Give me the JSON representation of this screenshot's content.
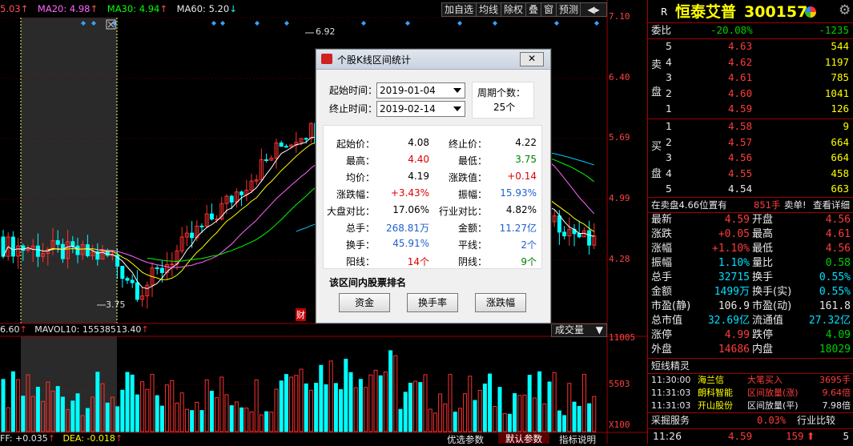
{
  "chart": {
    "ma_legend": [
      {
        "text": "5.03",
        "color": "#ff5050"
      },
      {
        "text": "MA20: 4.98",
        "color": "#ff66ff"
      },
      {
        "text": "MA30: 4.94",
        "color": "#00ff00"
      },
      {
        "text": "MA60: 5.20",
        "color": "#ffffff"
      }
    ],
    "price_ticks": [
      "7.10",
      "6.40",
      "5.69",
      "4.99",
      "4.28"
    ],
    "high_label": "6.92",
    "low_label": "3.75",
    "fin_label": "财",
    "vol_legend_left": "6.60",
    "vol_legend": "MAVOL10: 15538513.40",
    "vol_ticks": [
      "11005",
      "5503",
      "X100"
    ],
    "vol_select": "成交量",
    "indicator_text_1": "FF: +0.035",
    "indicator_text_2": "DEA: -0.018",
    "bottom_tabs": [
      "优选参数",
      "默认参数",
      "指标说明"
    ],
    "top_buttons": [
      "加自选",
      "均线",
      "除权",
      "叠",
      "窗",
      "预测"
    ],
    "colors": {
      "up": "#ff3030",
      "down": "#00ffff",
      "ma5": "#ffffff",
      "ma10": "#ffff00",
      "ma20": "#ff66ff",
      "ma30": "#00ff00",
      "ma60": "#00ccff"
    }
  },
  "dialog": {
    "title": "个股K线区间统计",
    "start_label": "起始时间：",
    "start_value": "2019-01-04",
    "end_label": "终止时间：",
    "end_value": "2019-02-14",
    "period_label": "周期个数：",
    "period_value": "25个",
    "stats_left": [
      {
        "k": "起始价：",
        "v": "4.08",
        "c": "#000000"
      },
      {
        "k": "最高：",
        "v": "4.40",
        "c": "#e00000"
      },
      {
        "k": "均价：",
        "v": "4.19",
        "c": "#000000"
      },
      {
        "k": "涨跌幅：",
        "v": "+3.43%",
        "c": "#e00000"
      },
      {
        "k": "大盘对比：",
        "v": "17.06%",
        "c": "#000000"
      },
      {
        "k": "总手：",
        "v": "268.81万",
        "c": "#1f5fd0"
      },
      {
        "k": "换手：",
        "v": "45.91%",
        "c": "#1f5fd0"
      },
      {
        "k": "阳线：",
        "v": "14个",
        "c": "#e00000"
      }
    ],
    "stats_right": [
      {
        "k": "终止价：",
        "v": "4.22",
        "c": "#000000"
      },
      {
        "k": "最低：",
        "v": "3.75",
        "c": "#008000"
      },
      {
        "k": "涨跌值：",
        "v": "+0.14",
        "c": "#e00000"
      },
      {
        "k": "振幅：",
        "v": "15.93%",
        "c": "#1f5fd0"
      },
      {
        "k": "行业对比：",
        "v": "4.82%",
        "c": "#000000"
      },
      {
        "k": "金额：",
        "v": "11.27亿",
        "c": "#1f5fd0"
      },
      {
        "k": "平线：",
        "v": "2个",
        "c": "#1f5fd0"
      },
      {
        "k": "阴线：",
        "v": "9个",
        "c": "#008000"
      }
    ],
    "rank_label": "该区间内股票排名",
    "buttons": [
      "资金",
      "换手率",
      "涨跌幅"
    ]
  },
  "panel": {
    "badge": "R",
    "name": "恒泰艾普",
    "code": "300157",
    "weibi_label": "委比",
    "weibi_pct": "-20.08%",
    "weibi_val": "-1235",
    "sell_side": [
      "卖",
      "盘"
    ],
    "buy_side": [
      "买",
      "盘"
    ],
    "sell": [
      {
        "n": "5",
        "p": "4.63",
        "v": "544"
      },
      {
        "n": "4",
        "p": "4.62",
        "v": "1197"
      },
      {
        "n": "3",
        "p": "4.61",
        "v": "785"
      },
      {
        "n": "2",
        "p": "4.60",
        "v": "1041"
      },
      {
        "n": "1",
        "p": "4.59",
        "v": "126"
      }
    ],
    "buy": [
      {
        "n": "1",
        "p": "4.58",
        "v": "9"
      },
      {
        "n": "2",
        "p": "4.57",
        "v": "664"
      },
      {
        "n": "3",
        "p": "4.56",
        "v": "664"
      },
      {
        "n": "4",
        "p": "4.55",
        "v": "458"
      },
      {
        "n": "5",
        "p": "4.54",
        "v": "663"
      }
    ],
    "sell_notice": "在卖盘4.66位置有",
    "sell_notice_vol": "851手",
    "sell_notice_tag": "卖单!",
    "detail_link": "查看详细",
    "quote": [
      {
        "l1": "最新",
        "v1": "4.59",
        "c1": "#ff3c3c",
        "l2": "开盘",
        "v2": "4.56",
        "c2": "#ff3c3c"
      },
      {
        "l1": "涨跌",
        "v1": "+0.05",
        "c1": "#ff3c3c",
        "l2": "最高",
        "v2": "4.61",
        "c2": "#ff3c3c"
      },
      {
        "l1": "涨幅",
        "v1": "+1.10%",
        "c1": "#ff3c3c",
        "l2": "最低",
        "v2": "4.56",
        "c2": "#ff3c3c"
      },
      {
        "l1": "振幅",
        "v1": "1.10%",
        "c1": "#00e0ff",
        "l2": "量比",
        "v2": "0.58",
        "c2": "#00d000"
      },
      {
        "l1": "总手",
        "v1": "32715",
        "c1": "#00e0ff",
        "l2": "换手",
        "v2": "0.55%",
        "c2": "#00e0ff"
      },
      {
        "l1": "金额",
        "v1": "1499万",
        "c1": "#00e0ff",
        "l2": "换手(实)",
        "v2": "0.55%",
        "c2": "#00e0ff"
      },
      {
        "l1": "市盈(静)",
        "v1": "106.9",
        "c1": "#e8e8e8",
        "l2": "市盈(动)",
        "v2": "161.8",
        "c2": "#e8e8e8"
      },
      {
        "l1": "总市值",
        "v1": "32.69亿",
        "c1": "#00e0ff",
        "l2": "流通值",
        "v2": "27.32亿",
        "c2": "#00e0ff"
      },
      {
        "l1": "涨停",
        "v1": "4.99",
        "c1": "#ff3c3c",
        "l2": "跌停",
        "v2": "4.09",
        "c2": "#00d000"
      },
      {
        "l1": "外盘",
        "v1": "14686",
        "c1": "#ff3c3c",
        "l2": "内盘",
        "v2": "18029",
        "c2": "#00d000"
      }
    ],
    "elf_title": "短线精灵",
    "elf": [
      {
        "t": "11:30:00",
        "s": "海兰信",
        "e": "大笔买入",
        "v": "3695手",
        "c": "#ff3c3c"
      },
      {
        "t": "11:31:03",
        "s": "朗科智能",
        "e": "区间放量(涨)",
        "v": "9.64倍",
        "c": "#ff3c3c"
      },
      {
        "t": "11:31:03",
        "s": "开山股份",
        "e": "区间放量(平)",
        "v": "7.98倍",
        "c": "#e8e8e8"
      }
    ],
    "svc_label": "采掘服务",
    "svc_pct": "0.03%",
    "svc_link": "行业比较",
    "bottom_time": "11:26",
    "bottom_price": "4.59",
    "bottom_vol": "159",
    "bottom_n": "5"
  }
}
